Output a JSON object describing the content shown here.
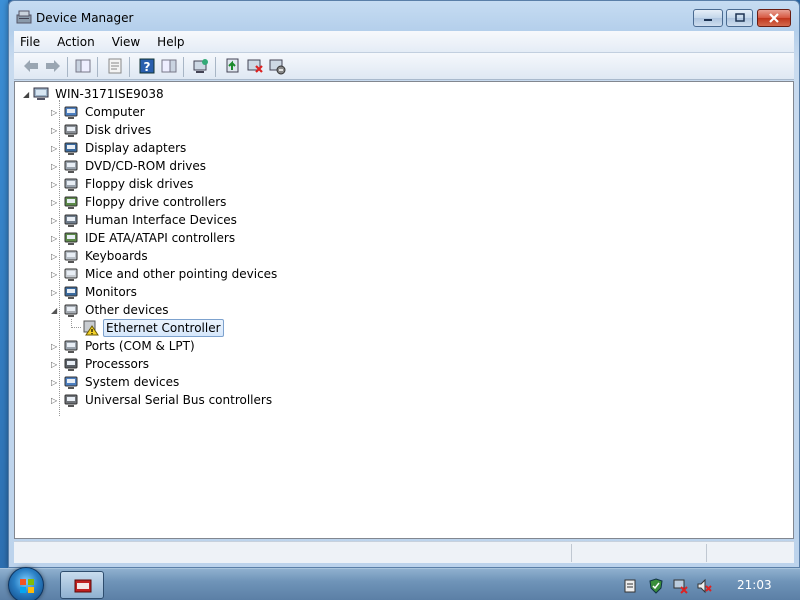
{
  "window": {
    "title": "Device Manager"
  },
  "menu": {
    "file": "File",
    "action": "Action",
    "view": "View",
    "help": "Help"
  },
  "tree": {
    "root": "WIN-3171ISE9038",
    "categories": [
      {
        "label": "Computer",
        "icon": "computer-icon"
      },
      {
        "label": "Disk drives",
        "icon": "disk-drive-icon"
      },
      {
        "label": "Display adapters",
        "icon": "display-adapter-icon"
      },
      {
        "label": "DVD/CD-ROM drives",
        "icon": "dvd-drive-icon"
      },
      {
        "label": "Floppy disk drives",
        "icon": "floppy-disk-icon"
      },
      {
        "label": "Floppy drive controllers",
        "icon": "floppy-controller-icon"
      },
      {
        "label": "Human Interface Devices",
        "icon": "hid-icon"
      },
      {
        "label": "IDE ATA/ATAPI controllers",
        "icon": "ide-controller-icon"
      },
      {
        "label": "Keyboards",
        "icon": "keyboard-icon"
      },
      {
        "label": "Mice and other pointing devices",
        "icon": "mouse-icon"
      },
      {
        "label": "Monitors",
        "icon": "monitor-icon"
      },
      {
        "label": "Other devices",
        "icon": "unknown-device-icon",
        "expanded": true
      },
      {
        "label": "Ports (COM & LPT)",
        "icon": "port-icon"
      },
      {
        "label": "Processors",
        "icon": "processor-icon"
      },
      {
        "label": "System devices",
        "icon": "system-device-icon"
      },
      {
        "label": "Universal Serial Bus controllers",
        "icon": "usb-icon"
      }
    ],
    "other_devices_child": "Ethernet Controller"
  },
  "taskbar": {
    "clock": "21:03"
  }
}
